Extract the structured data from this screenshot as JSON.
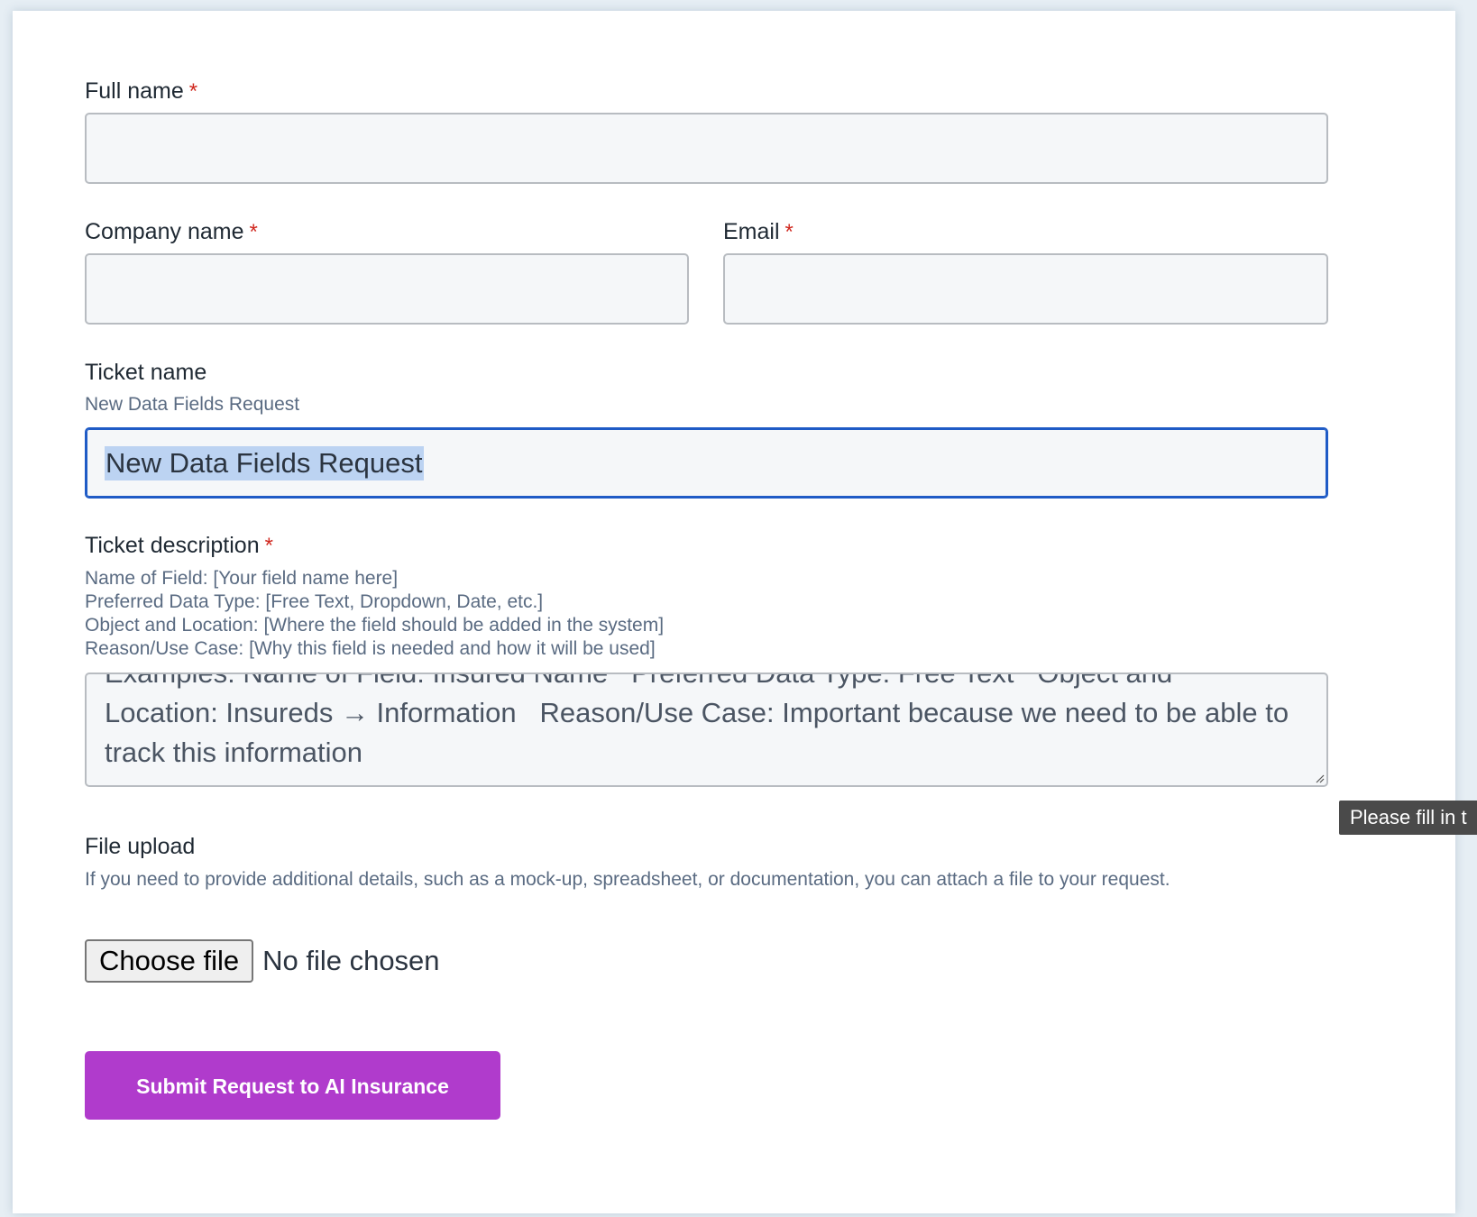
{
  "form": {
    "full_name": {
      "label": "Full name",
      "required_mark": "*"
    },
    "company_name": {
      "label": "Company name",
      "required_mark": "*"
    },
    "email": {
      "label": "Email",
      "required_mark": "*"
    },
    "ticket_name": {
      "label": "Ticket name",
      "help": "New Data Fields Request",
      "value": "New Data Fields Request"
    },
    "ticket_description": {
      "label": "Ticket description",
      "required_mark": "*",
      "help_lines": [
        "Name of Field: [Your field name here]",
        "Preferred Data Type: [Free Text, Dropdown, Date, etc.]",
        "Object and Location: [Where the field should be added in the system]",
        "Reason/Use Case: [Why this field is needed and how it will be used]"
      ],
      "value": "Examples: Name of Field: Insured Name   Preferred Data Type: Free Text   Object and Location: Insureds → Information   Reason/Use Case: Important because we need to be able to track this information"
    },
    "validation_tooltip": "Please fill in t",
    "file_upload": {
      "label": "File upload",
      "help": "If you need to provide additional details, such as a mock-up, spreadsheet, or documentation, you can attach a file to your request.",
      "button_label": "Choose file",
      "status": "No file chosen"
    },
    "submit_label": "Submit Request to AI Insurance"
  }
}
